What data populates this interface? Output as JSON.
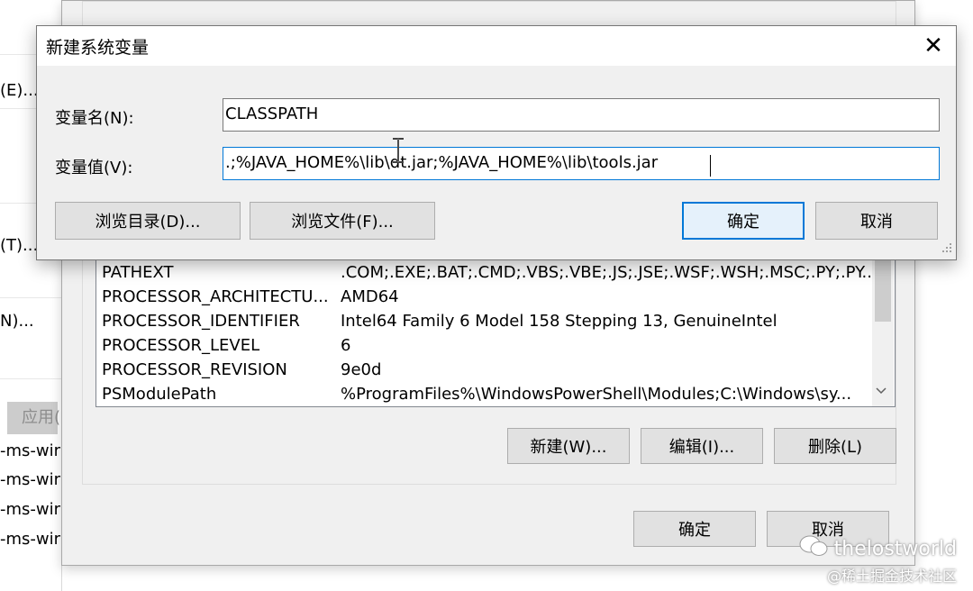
{
  "left_window": {
    "fragments": [
      "(E)...",
      "(T)...",
      "N)...",
      "应用(",
      "-ms-wir",
      "-ms-wir",
      "-ms-wir",
      "-ms-wir"
    ]
  },
  "env_window": {
    "variables": [
      {
        "name": "PATHEXT",
        "value": ".COM;.EXE;.BAT;.CMD;.VBS;.VBE;.JS;.JSE;.WSF;.WSH;.MSC;.PY;.PY..."
      },
      {
        "name": "PROCESSOR_ARCHITECTU...",
        "value": "AMD64"
      },
      {
        "name": "PROCESSOR_IDENTIFIER",
        "value": "Intel64 Family 6 Model 158 Stepping 13, GenuineIntel"
      },
      {
        "name": "PROCESSOR_LEVEL",
        "value": "6"
      },
      {
        "name": "PROCESSOR_REVISION",
        "value": "9e0d"
      },
      {
        "name": "PSModulePath",
        "value": "%ProgramFiles%\\WindowsPowerShell\\Modules;C:\\Windows\\sy..."
      }
    ],
    "new_label": "新建(W)...",
    "edit_label": "编辑(I)...",
    "delete_label": "删除(L)",
    "ok_label": "确定",
    "cancel_label": "取消"
  },
  "dialog": {
    "title": "新建系统变量",
    "close_glyph": "✕",
    "name_label": "变量名(N):",
    "name_value": "CLASSPATH",
    "value_label": "变量值(V):",
    "value_value": ".;%JAVA_HOME%\\lib\\dt.jar;%JAVA_HOME%\\lib\\tools.jar",
    "browse_dir_label": "浏览目录(D)...",
    "browse_file_label": "浏览文件(F)...",
    "ok_label": "确定",
    "cancel_label": "取消"
  },
  "watermark": {
    "brand": "thelostworld",
    "credit": "@稀土掘金技术社区"
  },
  "colors": {
    "dialog_bg": "#f0f0f0",
    "default_button_border": "#0078d7",
    "button_bg": "#e1e1e1"
  }
}
